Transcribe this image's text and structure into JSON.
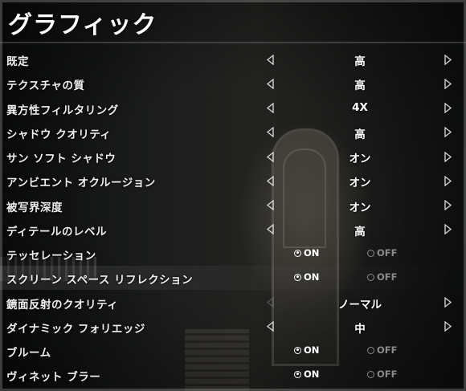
{
  "screen": {
    "title": "グラフィック"
  },
  "icons": {
    "left": "arrow-left-icon",
    "right": "arrow-right-icon",
    "radio_on": "radio-selected-icon",
    "radio_off": "radio-unselected-icon"
  },
  "colors": {
    "text": "#f0f0f0",
    "disabled": "#8a8a8a"
  },
  "settings": [
    {
      "label": "既定",
      "type": "select",
      "value": "高",
      "left_enabled": true
    },
    {
      "label": "テクスチャの質",
      "type": "select",
      "value": "高",
      "left_enabled": true
    },
    {
      "label": "異方性フィルタリング",
      "type": "select",
      "value": "4X",
      "left_enabled": true
    },
    {
      "label": "シャドウ クオリティ",
      "type": "select",
      "value": "高",
      "left_enabled": true
    },
    {
      "label": "サン ソフト シャドウ",
      "type": "select",
      "value": "オン",
      "left_enabled": true
    },
    {
      "label": "アンビエント オクルージョン",
      "type": "select",
      "value": "オン",
      "left_enabled": true
    },
    {
      "label": "被写界深度",
      "type": "select",
      "value": "オン",
      "left_enabled": true
    },
    {
      "label": "ディテールのレベル",
      "type": "select",
      "value": "高",
      "left_enabled": true
    },
    {
      "label": "テッセレーション",
      "type": "toggle",
      "on_label": "ON",
      "off_label": "OFF",
      "selected": "on"
    },
    {
      "label": "スクリーン スペース リフレクション",
      "type": "toggle",
      "on_label": "ON",
      "off_label": "OFF",
      "selected": "on"
    },
    {
      "label": "鏡面反射のクオリティ",
      "type": "select",
      "value": "ノーマル",
      "left_enabled": false
    },
    {
      "label": "ダイナミック フォリエッジ",
      "type": "select",
      "value": "中",
      "left_enabled": true
    },
    {
      "label": "ブルーム",
      "type": "toggle",
      "on_label": "ON",
      "off_label": "OFF",
      "selected": "on"
    },
    {
      "label": "ヴィネット ブラー",
      "type": "toggle",
      "on_label": "ON",
      "off_label": "OFF",
      "selected": "on"
    }
  ]
}
